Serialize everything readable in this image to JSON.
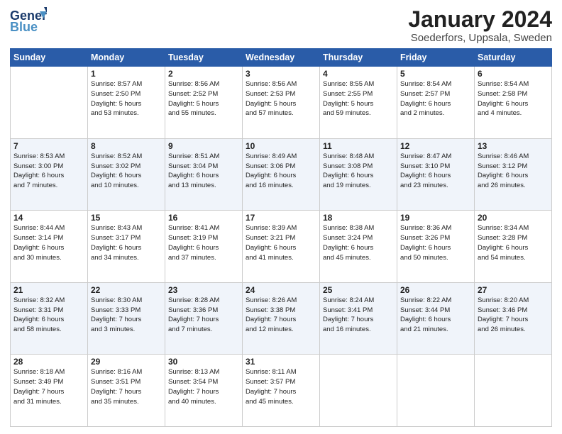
{
  "header": {
    "logo_line1": "General",
    "logo_line2": "Blue",
    "month": "January 2024",
    "location": "Soederfors, Uppsala, Sweden"
  },
  "weekdays": [
    "Sunday",
    "Monday",
    "Tuesday",
    "Wednesday",
    "Thursday",
    "Friday",
    "Saturday"
  ],
  "weeks": [
    [
      {
        "date": "",
        "info": ""
      },
      {
        "date": "1",
        "info": "Sunrise: 8:57 AM\nSunset: 2:50 PM\nDaylight: 5 hours\nand 53 minutes."
      },
      {
        "date": "2",
        "info": "Sunrise: 8:56 AM\nSunset: 2:52 PM\nDaylight: 5 hours\nand 55 minutes."
      },
      {
        "date": "3",
        "info": "Sunrise: 8:56 AM\nSunset: 2:53 PM\nDaylight: 5 hours\nand 57 minutes."
      },
      {
        "date": "4",
        "info": "Sunrise: 8:55 AM\nSunset: 2:55 PM\nDaylight: 5 hours\nand 59 minutes."
      },
      {
        "date": "5",
        "info": "Sunrise: 8:54 AM\nSunset: 2:57 PM\nDaylight: 6 hours\nand 2 minutes."
      },
      {
        "date": "6",
        "info": "Sunrise: 8:54 AM\nSunset: 2:58 PM\nDaylight: 6 hours\nand 4 minutes."
      }
    ],
    [
      {
        "date": "7",
        "info": "Sunrise: 8:53 AM\nSunset: 3:00 PM\nDaylight: 6 hours\nand 7 minutes."
      },
      {
        "date": "8",
        "info": "Sunrise: 8:52 AM\nSunset: 3:02 PM\nDaylight: 6 hours\nand 10 minutes."
      },
      {
        "date": "9",
        "info": "Sunrise: 8:51 AM\nSunset: 3:04 PM\nDaylight: 6 hours\nand 13 minutes."
      },
      {
        "date": "10",
        "info": "Sunrise: 8:49 AM\nSunset: 3:06 PM\nDaylight: 6 hours\nand 16 minutes."
      },
      {
        "date": "11",
        "info": "Sunrise: 8:48 AM\nSunset: 3:08 PM\nDaylight: 6 hours\nand 19 minutes."
      },
      {
        "date": "12",
        "info": "Sunrise: 8:47 AM\nSunset: 3:10 PM\nDaylight: 6 hours\nand 23 minutes."
      },
      {
        "date": "13",
        "info": "Sunrise: 8:46 AM\nSunset: 3:12 PM\nDaylight: 6 hours\nand 26 minutes."
      }
    ],
    [
      {
        "date": "14",
        "info": "Sunrise: 8:44 AM\nSunset: 3:14 PM\nDaylight: 6 hours\nand 30 minutes."
      },
      {
        "date": "15",
        "info": "Sunrise: 8:43 AM\nSunset: 3:17 PM\nDaylight: 6 hours\nand 34 minutes."
      },
      {
        "date": "16",
        "info": "Sunrise: 8:41 AM\nSunset: 3:19 PM\nDaylight: 6 hours\nand 37 minutes."
      },
      {
        "date": "17",
        "info": "Sunrise: 8:39 AM\nSunset: 3:21 PM\nDaylight: 6 hours\nand 41 minutes."
      },
      {
        "date": "18",
        "info": "Sunrise: 8:38 AM\nSunset: 3:24 PM\nDaylight: 6 hours\nand 45 minutes."
      },
      {
        "date": "19",
        "info": "Sunrise: 8:36 AM\nSunset: 3:26 PM\nDaylight: 6 hours\nand 50 minutes."
      },
      {
        "date": "20",
        "info": "Sunrise: 8:34 AM\nSunset: 3:28 PM\nDaylight: 6 hours\nand 54 minutes."
      }
    ],
    [
      {
        "date": "21",
        "info": "Sunrise: 8:32 AM\nSunset: 3:31 PM\nDaylight: 6 hours\nand 58 minutes."
      },
      {
        "date": "22",
        "info": "Sunrise: 8:30 AM\nSunset: 3:33 PM\nDaylight: 7 hours\nand 3 minutes."
      },
      {
        "date": "23",
        "info": "Sunrise: 8:28 AM\nSunset: 3:36 PM\nDaylight: 7 hours\nand 7 minutes."
      },
      {
        "date": "24",
        "info": "Sunrise: 8:26 AM\nSunset: 3:38 PM\nDaylight: 7 hours\nand 12 minutes."
      },
      {
        "date": "25",
        "info": "Sunrise: 8:24 AM\nSunset: 3:41 PM\nDaylight: 7 hours\nand 16 minutes."
      },
      {
        "date": "26",
        "info": "Sunrise: 8:22 AM\nSunset: 3:44 PM\nDaylight: 6 hours\nand 21 minutes."
      },
      {
        "date": "27",
        "info": "Sunrise: 8:20 AM\nSunset: 3:46 PM\nDaylight: 7 hours\nand 26 minutes."
      }
    ],
    [
      {
        "date": "28",
        "info": "Sunrise: 8:18 AM\nSunset: 3:49 PM\nDaylight: 7 hours\nand 31 minutes."
      },
      {
        "date": "29",
        "info": "Sunrise: 8:16 AM\nSunset: 3:51 PM\nDaylight: 7 hours\nand 35 minutes."
      },
      {
        "date": "30",
        "info": "Sunrise: 8:13 AM\nSunset: 3:54 PM\nDaylight: 7 hours\nand 40 minutes."
      },
      {
        "date": "31",
        "info": "Sunrise: 8:11 AM\nSunset: 3:57 PM\nDaylight: 7 hours\nand 45 minutes."
      },
      {
        "date": "",
        "info": ""
      },
      {
        "date": "",
        "info": ""
      },
      {
        "date": "",
        "info": ""
      }
    ]
  ]
}
